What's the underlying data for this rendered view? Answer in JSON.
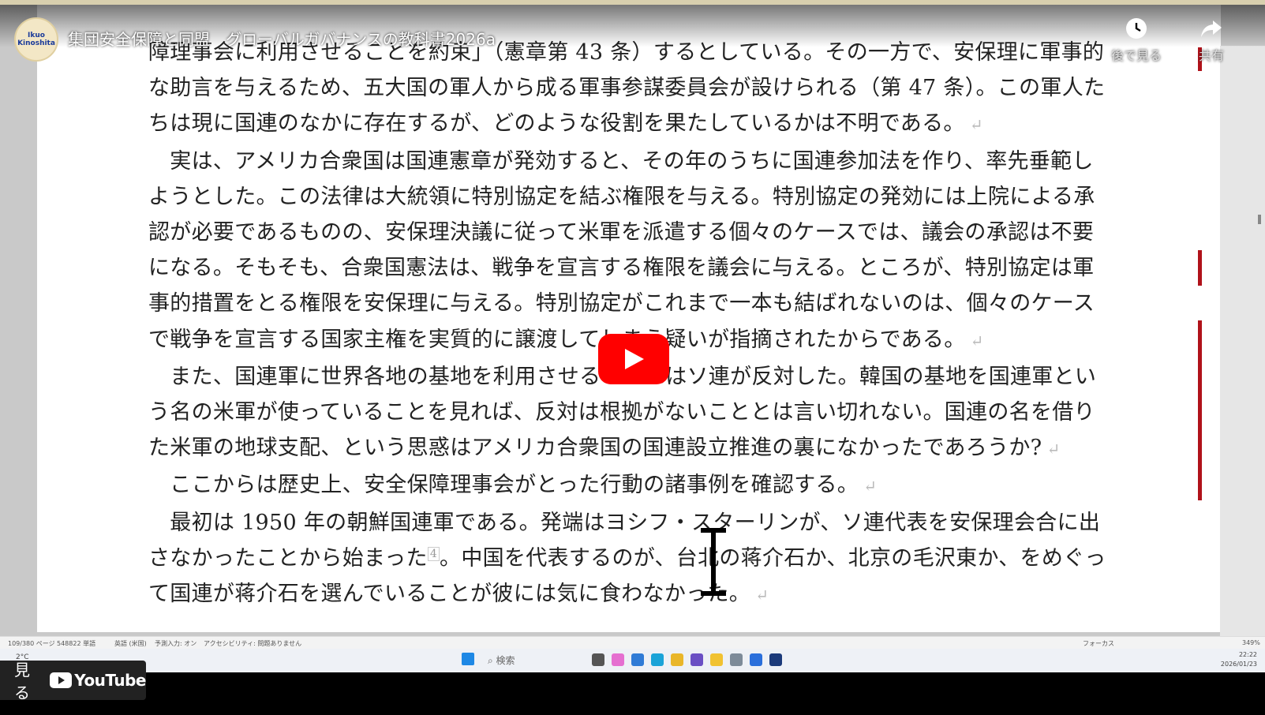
{
  "video": {
    "title": "集団安全保障と同盟　グローバルガバナンスの教科書2026a",
    "channel_logo_text": "Ikuo Kinoshita",
    "watch_later_label": "後で見る",
    "share_label": "共有",
    "watch_on_label": "見る",
    "youtube_label": "YouTube"
  },
  "document": {
    "lines": [
      "障理事会に利用させることを約束」（憲章第 43 条）するとしている。その一方で、安保理に軍事的",
      "な助言を与えるため、五大国の軍人から成る軍事参謀委員会が設けられる（第 47 条）。この軍人た",
      "ちは現に国連のなかに存在するが、どのような役割を果たしているかは不明である。",
      "　実は、アメリカ合衆国は国連憲章が発効すると、その年のうちに国連参加法を作り、率先垂範し",
      "ようとした。この法律は大統領に特別協定を結ぶ権限を与える。特別協定の発効には上院による承",
      "認が必要であるものの、安保理決議に従って米軍を派遣する個々のケースでは、議会の承認は不要",
      "になる。そもそも、合衆国憲法は、戦争を宣言する権限を議会に与える。ところが、特別協定は軍",
      "事的措置をとる権限を安保理に与える。特別協定がこれまで一本も結ばれないのは、個々のケース",
      "で戦争を宣言する国家主権を実質的に譲渡してしまう疑いが指摘されたからである。",
      "　また、国連軍に世界各地の基地を利用させることにはソ連が反対した。韓国の基地を国連軍とい",
      "う名の米軍が使っていることを見れば、反対は根拠がないこととは言い切れない。国連の名を借り",
      "た米軍の地球支配、という思惑はアメリカ合衆国の国連設立推進の裏になかったであろうか?",
      "　ここからは歴史上、安全保障理事会がとった行動の諸事例を確認する。",
      "　最初は 1950 年の朝鮮国連軍である。発端はヨシフ・スターリンが、ソ連代表を安保理会合に出",
      "さなかったことから始まった",
      "。中国を代表するのが、台北の蒋介石か、北京の毛沢東か、をめぐっ",
      "て国連が蒋介石を選んでいることが彼には気に食わなかった。"
    ],
    "footnote_marker": "4",
    "paragraph_mark": "↵"
  },
  "statusbar": {
    "page": "109/380 ページ",
    "words": "548822 単語",
    "language": "英語 (米国)",
    "predict": "予測入力: オン",
    "accessibility": "アクセシビリティ: 問題ありません",
    "focus": "フォーカス",
    "zoom": "349%"
  },
  "taskbar": {
    "search_placeholder": "検索",
    "temperature": "2°C",
    "time": "22:22",
    "date": "2026/01/23"
  },
  "colors": {
    "accent_red": "#b0121a",
    "play_red": "#ff0000"
  }
}
